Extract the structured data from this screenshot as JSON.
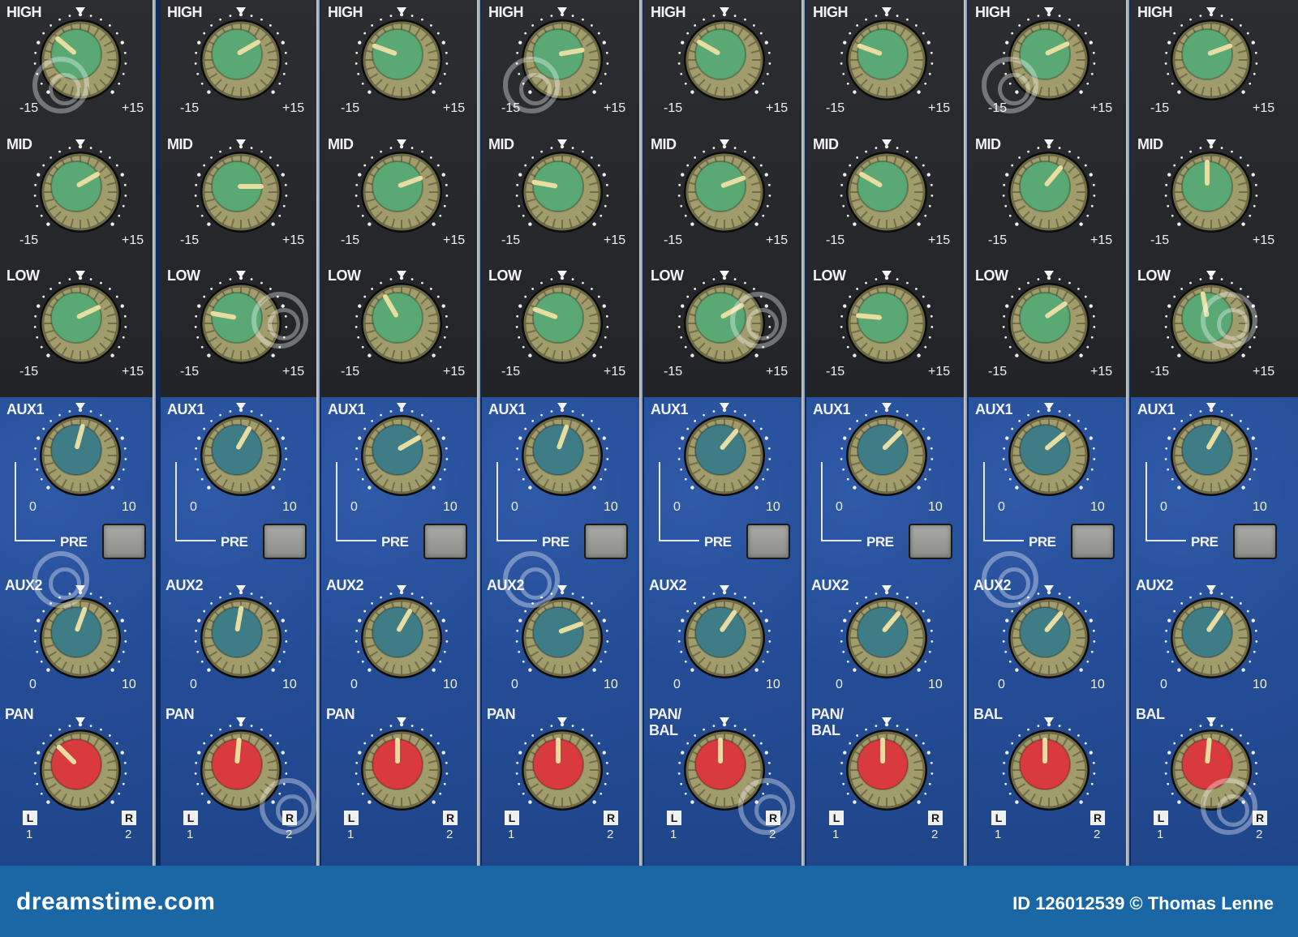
{
  "strips": [
    {
      "eq": [
        {
          "label": "HIGH",
          "min": "-15",
          "max": "+15",
          "angle": -50
        },
        {
          "label": "MID",
          "min": "-15",
          "max": "+15",
          "angle": 60
        },
        {
          "label": "LOW",
          "min": "-15",
          "max": "+15",
          "angle": 65
        }
      ],
      "aux1": {
        "label": "AUX1",
        "min": "0",
        "max": "10",
        "angle": 15
      },
      "pre_label": "PRE",
      "aux2": {
        "label": "AUX2",
        "min": "0",
        "max": "10",
        "angle": 20
      },
      "pan": {
        "label": "PAN",
        "angle": -45
      },
      "left": "L",
      "right": "R",
      "left_num": "1",
      "right_num": "2"
    },
    {
      "eq": [
        {
          "label": "HIGH",
          "min": "-15",
          "max": "+15",
          "angle": 60
        },
        {
          "label": "MID",
          "min": "-15",
          "max": "+15",
          "angle": 90
        },
        {
          "label": "LOW",
          "min": "-15",
          "max": "+15",
          "angle": -80
        }
      ],
      "aux1": {
        "label": "AUX1",
        "min": "0",
        "max": "10",
        "angle": 30
      },
      "pre_label": "PRE",
      "aux2": {
        "label": "AUX2",
        "min": "0",
        "max": "10",
        "angle": 10
      },
      "pan": {
        "label": "PAN",
        "angle": 5
      },
      "left": "L",
      "right": "R",
      "left_num": "1",
      "right_num": "2"
    },
    {
      "eq": [
        {
          "label": "HIGH",
          "min": "-15",
          "max": "+15",
          "angle": -70
        },
        {
          "label": "MID",
          "min": "-15",
          "max": "+15",
          "angle": 70
        },
        {
          "label": "LOW",
          "min": "-15",
          "max": "+15",
          "angle": -30
        }
      ],
      "aux1": {
        "label": "AUX1",
        "min": "0",
        "max": "10",
        "angle": 60
      },
      "pre_label": "PRE",
      "aux2": {
        "label": "AUX2",
        "min": "0",
        "max": "10",
        "angle": 30
      },
      "pan": {
        "label": "PAN",
        "angle": 0
      },
      "left": "L",
      "right": "R",
      "left_num": "1",
      "right_num": "2"
    },
    {
      "eq": [
        {
          "label": "HIGH",
          "min": "-15",
          "max": "+15",
          "angle": 80
        },
        {
          "label": "MID",
          "min": "-15",
          "max": "+15",
          "angle": -80
        },
        {
          "label": "LOW",
          "min": "-15",
          "max": "+15",
          "angle": -70
        }
      ],
      "aux1": {
        "label": "AUX1",
        "min": "0",
        "max": "10",
        "angle": 20
      },
      "pre_label": "PRE",
      "aux2": {
        "label": "AUX2",
        "min": "0",
        "max": "10",
        "angle": 70
      },
      "pan": {
        "label": "PAN",
        "angle": 0
      },
      "left": "L",
      "right": "R",
      "left_num": "1",
      "right_num": "2"
    },
    {
      "eq": [
        {
          "label": "HIGH",
          "min": "-15",
          "max": "+15",
          "angle": -60
        },
        {
          "label": "MID",
          "min": "-15",
          "max": "+15",
          "angle": 70
        },
        {
          "label": "LOW",
          "min": "-15",
          "max": "+15",
          "angle": 60
        }
      ],
      "aux1": {
        "label": "AUX1",
        "min": "0",
        "max": "10",
        "angle": 40
      },
      "pre_label": "PRE",
      "aux2": {
        "label": "AUX2",
        "min": "0",
        "max": "10",
        "angle": 35
      },
      "pan": {
        "label": "PAN/\nBAL",
        "angle": 0
      },
      "left": "L",
      "right": "R",
      "left_num": "1",
      "right_num": "2"
    },
    {
      "eq": [
        {
          "label": "HIGH",
          "min": "-15",
          "max": "+15",
          "angle": -70
        },
        {
          "label": "MID",
          "min": "-15",
          "max": "+15",
          "angle": -60
        },
        {
          "label": "LOW",
          "min": "-15",
          "max": "+15",
          "angle": -85
        }
      ],
      "aux1": {
        "label": "AUX1",
        "min": "0",
        "max": "10",
        "angle": 45
      },
      "pre_label": "PRE",
      "aux2": {
        "label": "AUX2",
        "min": "0",
        "max": "10",
        "angle": 40
      },
      "pan": {
        "label": "PAN/\nBAL",
        "angle": 0
      },
      "left": "L",
      "right": "R",
      "left_num": "1",
      "right_num": "2"
    },
    {
      "eq": [
        {
          "label": "HIGH",
          "min": "-15",
          "max": "+15",
          "angle": 65
        },
        {
          "label": "MID",
          "min": "-15",
          "max": "+15",
          "angle": 40
        },
        {
          "label": "LOW",
          "min": "-15",
          "max": "+15",
          "angle": 55
        }
      ],
      "aux1": {
        "label": "AUX1",
        "min": "0",
        "max": "10",
        "angle": 50
      },
      "pre_label": "PRE",
      "aux2": {
        "label": "AUX2",
        "min": "0",
        "max": "10",
        "angle": 40
      },
      "pan": {
        "label": "BAL",
        "angle": 0
      },
      "left": "L",
      "right": "R",
      "left_num": "1",
      "right_num": "2"
    },
    {
      "eq": [
        {
          "label": "HIGH",
          "min": "-15",
          "max": "+15",
          "angle": 70
        },
        {
          "label": "MID",
          "min": "-15",
          "max": "+15",
          "angle": 0
        },
        {
          "label": "LOW",
          "min": "-15",
          "max": "+15",
          "angle": -10
        }
      ],
      "aux1": {
        "label": "AUX1",
        "min": "0",
        "max": "10",
        "angle": 30
      },
      "pre_label": "PRE",
      "aux2": {
        "label": "AUX2",
        "min": "0",
        "max": "10",
        "angle": 35
      },
      "pan": {
        "label": "BAL",
        "angle": 5
      },
      "left": "L",
      "right": "R",
      "left_num": "1",
      "right_num": "2"
    }
  ],
  "colors": {
    "eq_cap": "#5aa874",
    "aux_cap": "#3f7d86",
    "pan_cap": "#d83a3e",
    "skirt": "#a19c6c",
    "panel_top": "#26282b",
    "panel_bottom": "#24498f",
    "footer": "#1b67a6"
  },
  "footer": {
    "brand": "dreamstime.com",
    "credit": "ID 126012539 © Thomas Lenne"
  }
}
